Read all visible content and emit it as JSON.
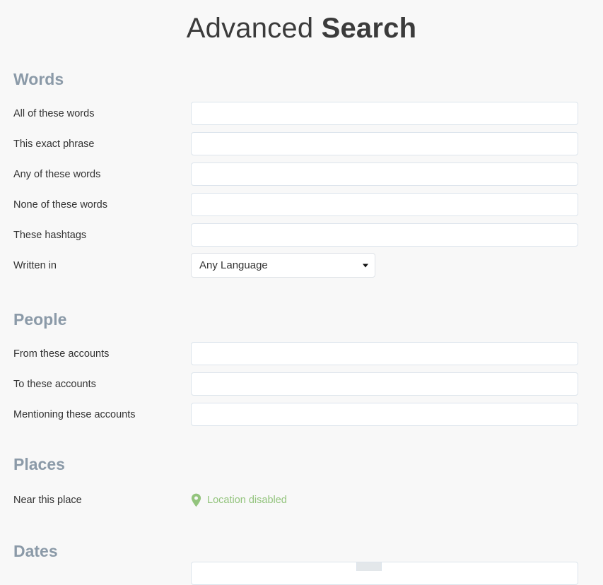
{
  "title": {
    "normal": "Advanced ",
    "bold": "Search"
  },
  "sections": {
    "words": {
      "heading": "Words",
      "rows": [
        {
          "label": "All of these words",
          "value": "",
          "type": "text"
        },
        {
          "label": "This exact phrase",
          "value": "",
          "type": "text"
        },
        {
          "label": "Any of these words",
          "value": "",
          "type": "text"
        },
        {
          "label": "None of these words",
          "value": "",
          "type": "text"
        },
        {
          "label": "These hashtags",
          "value": "",
          "type": "text"
        }
      ],
      "language_row": {
        "label": "Written in",
        "selected": "Any Language"
      }
    },
    "people": {
      "heading": "People",
      "rows": [
        {
          "label": "From these accounts",
          "value": "",
          "type": "text"
        },
        {
          "label": "To these accounts",
          "value": "",
          "type": "text"
        },
        {
          "label": "Mentioning these accounts",
          "value": "",
          "type": "text"
        }
      ]
    },
    "places": {
      "heading": "Places",
      "row": {
        "label": "Near this place",
        "icon": "map-pin-icon",
        "status_text": "Location disabled",
        "status_color": "#93c47d"
      }
    },
    "dates": {
      "heading": "Dates"
    }
  },
  "colors": {
    "page_background": "#f8f8f8",
    "heading": "#8b9aa8",
    "label": "#333333",
    "input_border": "#dce4ec",
    "title": "#3b3b3b",
    "accent_green": "#93c47d"
  }
}
